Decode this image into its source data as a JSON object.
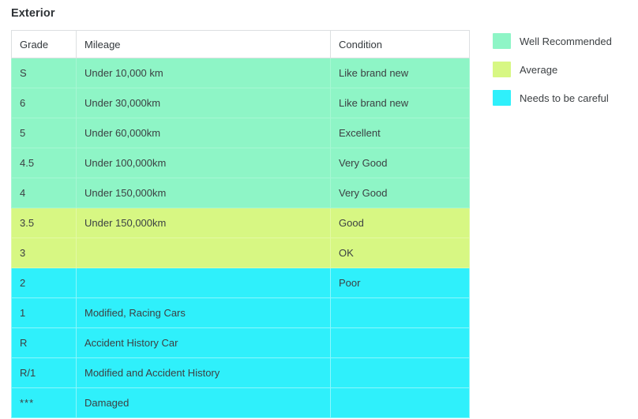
{
  "section": {
    "title": "Exterior"
  },
  "table": {
    "columns": [
      {
        "key": "grade",
        "label": "Grade"
      },
      {
        "key": "mileage",
        "label": "Mileage"
      },
      {
        "key": "condition",
        "label": "Condition"
      }
    ],
    "rows": [
      {
        "grade": "S",
        "mileage": "Under 10,000 km",
        "condition": "Like brand new",
        "band": "well"
      },
      {
        "grade": "6",
        "mileage": "Under 30,000km",
        "condition": "Like brand new",
        "band": "well"
      },
      {
        "grade": "5",
        "mileage": "Under 60,000km",
        "condition": "Excellent",
        "band": "well"
      },
      {
        "grade": "4.5",
        "mileage": "Under 100,000km",
        "condition": "Very Good",
        "band": "well"
      },
      {
        "grade": "4",
        "mileage": "Under 150,000km",
        "condition": "Very Good",
        "band": "well"
      },
      {
        "grade": "3.5",
        "mileage": "Under 150,000km",
        "condition": "Good",
        "band": "avg"
      },
      {
        "grade": "3",
        "mileage": "",
        "condition": "OK",
        "band": "avg"
      },
      {
        "grade": "2",
        "mileage": "",
        "condition": "Poor",
        "band": "care"
      },
      {
        "grade": "1",
        "mileage": "Modified, Racing Cars",
        "condition": "",
        "band": "care"
      },
      {
        "grade": "R",
        "mileage": "Accident History Car",
        "condition": "",
        "band": "care"
      },
      {
        "grade": "R/1",
        "mileage": "Modified and Accident History",
        "condition": "",
        "band": "care"
      },
      {
        "grade": "***",
        "mileage": "Damaged",
        "condition": "",
        "band": "care"
      }
    ]
  },
  "legend": {
    "items": [
      {
        "label": "Well Recommended",
        "color": "#8ef5c6",
        "band": "well"
      },
      {
        "label": "Average",
        "color": "#d7f783",
        "band": "avg"
      },
      {
        "label": "Needs to be careful",
        "color": "#2ff0fb",
        "band": "care"
      }
    ]
  },
  "colors": {
    "well_recommended": "#8ef5c6",
    "average": "#d7f783",
    "needs_care": "#2ff0fb",
    "text": "#3c4043",
    "border": "#e6e9ea",
    "background": "#ffffff"
  }
}
